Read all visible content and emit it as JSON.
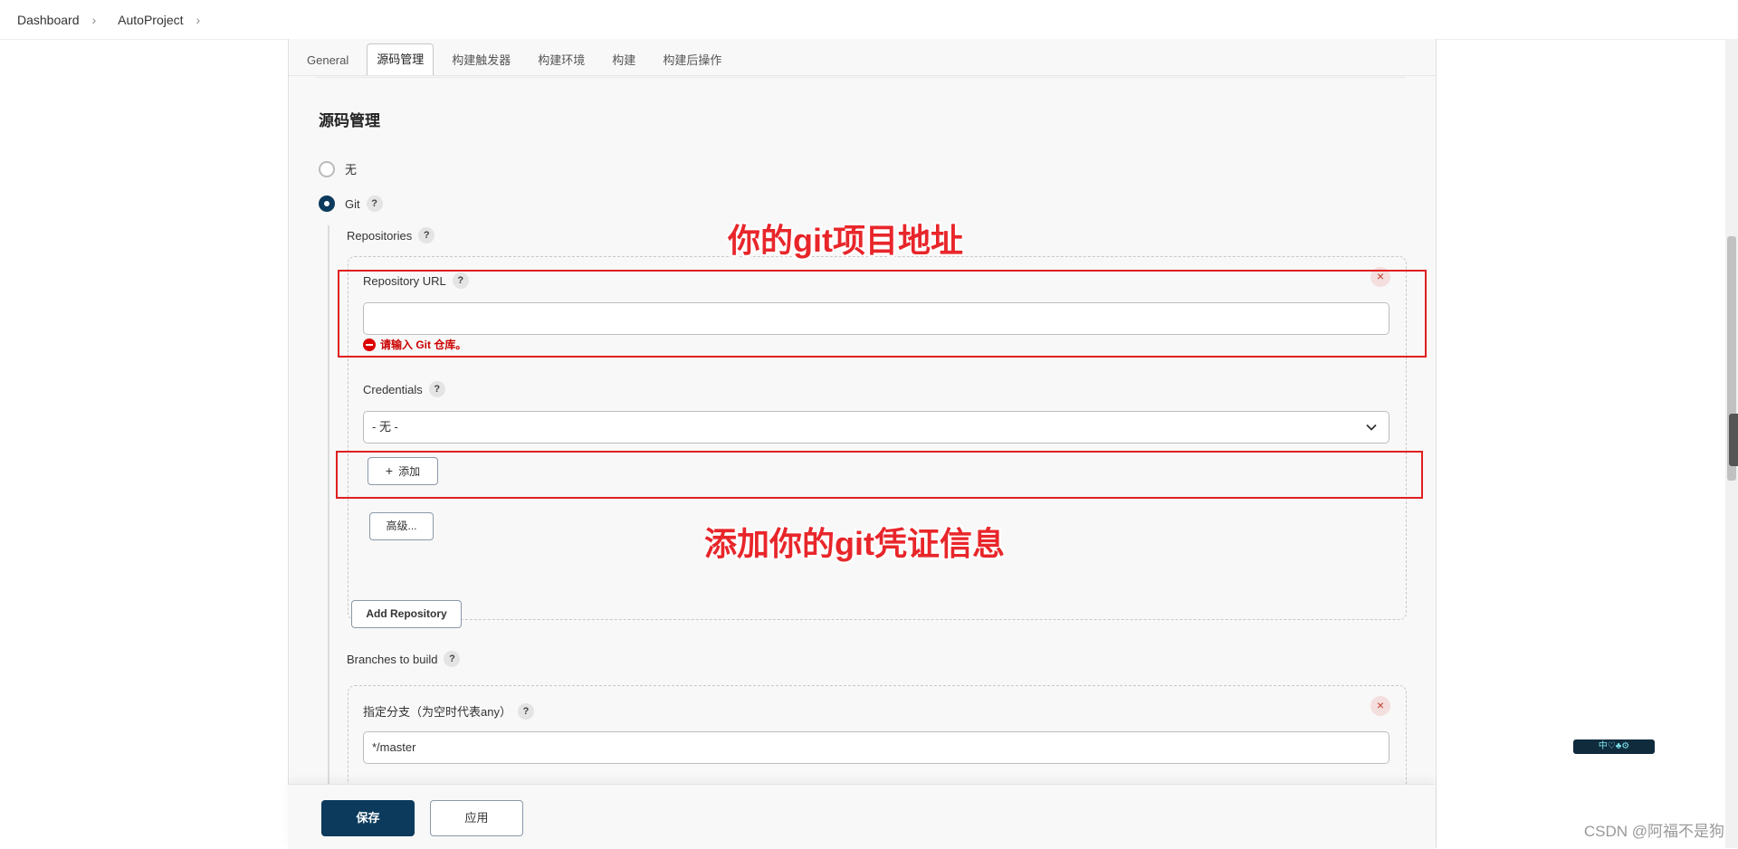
{
  "breadcrumb": {
    "items": [
      "Dashboard",
      "AutoProject"
    ]
  },
  "tabs": [
    "General",
    "源码管理",
    "构建触发器",
    "构建环境",
    "构建",
    "构建后操作"
  ],
  "section_title": "源码管理",
  "scm": {
    "option_none": "无",
    "option_git": "Git",
    "help_glyph": "?",
    "repositories_label": "Repositories",
    "repository_url_label": "Repository URL",
    "repository_url_value": "",
    "error_text": "请输入 Git 仓库。",
    "credentials_label": "Credentials",
    "credentials_selected": "- 无 -",
    "add_button": "添加",
    "add_glyph": "+",
    "advanced_button": "高级...",
    "add_repository_button": "Add Repository",
    "branches_label": "Branches to build",
    "branch_spec_label": "指定分支（为空时代表any）",
    "branch_spec_value": "*/master",
    "remove_glyph": "×"
  },
  "annotations": {
    "repo_note": "你的git项目地址",
    "cred_note": "添加你的git凭证信息",
    "color": "#e8262a"
  },
  "footer": {
    "save": "保存",
    "apply": "应用"
  },
  "watermark": "CSDN @阿福不是狗",
  "widget": "中♡♣⚙",
  "colors": {
    "primary": "#0b3a5c",
    "error": "#cc0000",
    "annotation": "#e8262a"
  }
}
